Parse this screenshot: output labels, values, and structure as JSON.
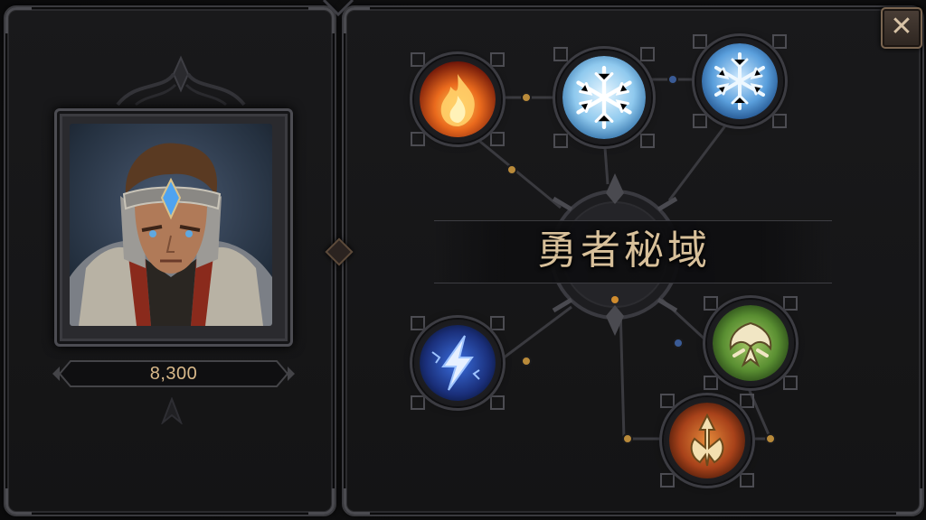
{
  "title": "勇者秘域",
  "hero": {
    "portrait_icon": "armored-knight-portrait",
    "score": "8,300"
  },
  "close_button": {
    "label": "✕",
    "icon": "close-icon"
  },
  "skills": [
    {
      "id": "fire",
      "icon": "flame-icon",
      "accent": "#e8621c"
    },
    {
      "id": "frost-large",
      "icon": "snowflake-icon",
      "accent": "#8fc9ee"
    },
    {
      "id": "frost-small",
      "icon": "snowflake-icon",
      "accent": "#5a9fdc"
    },
    {
      "id": "lightning",
      "icon": "lightning-bolt-icon",
      "accent": "#3b6fe0"
    },
    {
      "id": "nature",
      "icon": "leaf-crest-icon",
      "accent": "#5a8f32"
    },
    {
      "id": "might",
      "icon": "trident-crest-icon",
      "accent": "#c25a1c"
    }
  ],
  "colors": {
    "title_gold": "#d8c09a",
    "score_gold": "#d9b98a",
    "connector_gold": "#b98a3a",
    "connector_blue": "#3a5b96"
  }
}
